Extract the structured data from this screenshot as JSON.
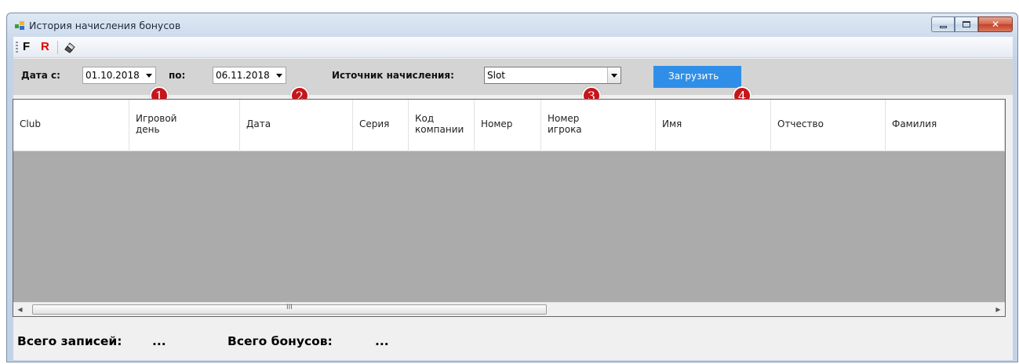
{
  "window": {
    "title": "История начисления бонусов",
    "controls": {
      "minimize": "▭",
      "maximize": "▢",
      "close": "✕"
    }
  },
  "toolbar": {
    "f_label": "F",
    "r_label": "R",
    "eraser_icon": "eraser-icon",
    "r_color": "#e00000"
  },
  "filters": {
    "date_from_label": "Дата с:",
    "date_from_value": "01.10.2018",
    "date_to_label": "по:",
    "date_to_value": "06.11.2018",
    "source_label": "Источник начисления:",
    "source_value": "Slot",
    "load_button": "Загрузить",
    "load_button_color": "#2f8fe8"
  },
  "badges": [
    "1",
    "2",
    "3",
    "4"
  ],
  "badge_color": "#c6161b",
  "table": {
    "columns": [
      "Club",
      "Игровой\nдень",
      "Дата",
      "Серия",
      "Код\nкомпании",
      "Номер",
      "Номер\nигрока",
      "Имя",
      "Отчество",
      "Фамилия"
    ],
    "rows": [],
    "scroll_thumb_text": "III"
  },
  "footer": {
    "total_records_label": "Всего записей:",
    "total_records_value": "...",
    "total_bonuses_label": "Всего бонусов:",
    "total_bonuses_value": "..."
  }
}
